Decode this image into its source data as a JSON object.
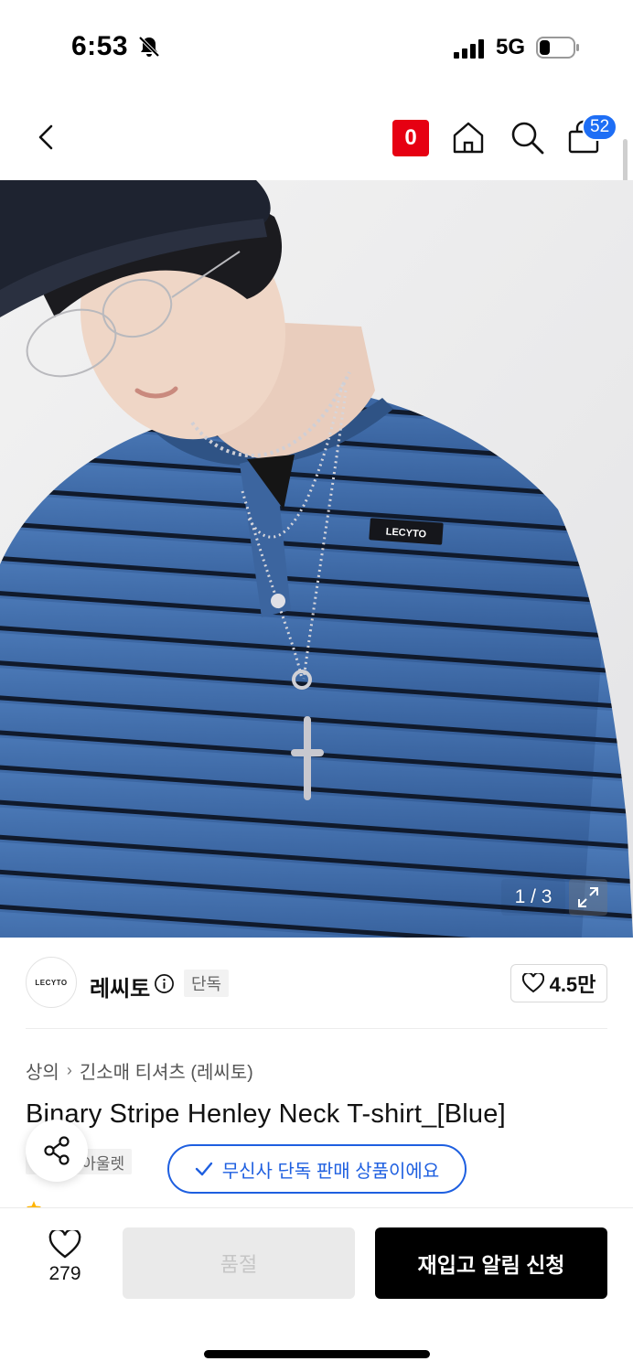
{
  "status_bar": {
    "time": "6:53",
    "network": "5G",
    "icons": [
      "bell-off-icon",
      "signal-icon",
      "battery-icon"
    ]
  },
  "nav": {
    "brand_mark": "0",
    "cart_count": "52",
    "icons": [
      "back-arrow-icon",
      "home-icon",
      "search-icon",
      "cart-icon"
    ]
  },
  "image": {
    "counter": "1 / 3",
    "shirt_label": "LECYTO",
    "expand_icon": "expand-icon"
  },
  "brand": {
    "logo_text": "LECYTO",
    "name": "레씨토",
    "tag": "단독",
    "likes": "4.5만"
  },
  "product": {
    "breadcrumb": [
      "상의",
      "긴소매 티셔츠 (레씨토)"
    ],
    "title": "Binary Stripe Henley Neck T-shirt_[Blue]",
    "tags": [
      "단독",
      "아울렛"
    ],
    "exclusive_notice": "무신사 단독 판매 상품이에요"
  },
  "bottom_bar": {
    "wish_count": "279",
    "soldout_label": "품절",
    "restock_label": "재입고 알림 신청"
  },
  "colors": {
    "accent_blue": "#1e5fe0",
    "badge_blue": "#1e6ef5",
    "brand_red": "#e60012",
    "shirt_blue": "#3f6aa6"
  }
}
